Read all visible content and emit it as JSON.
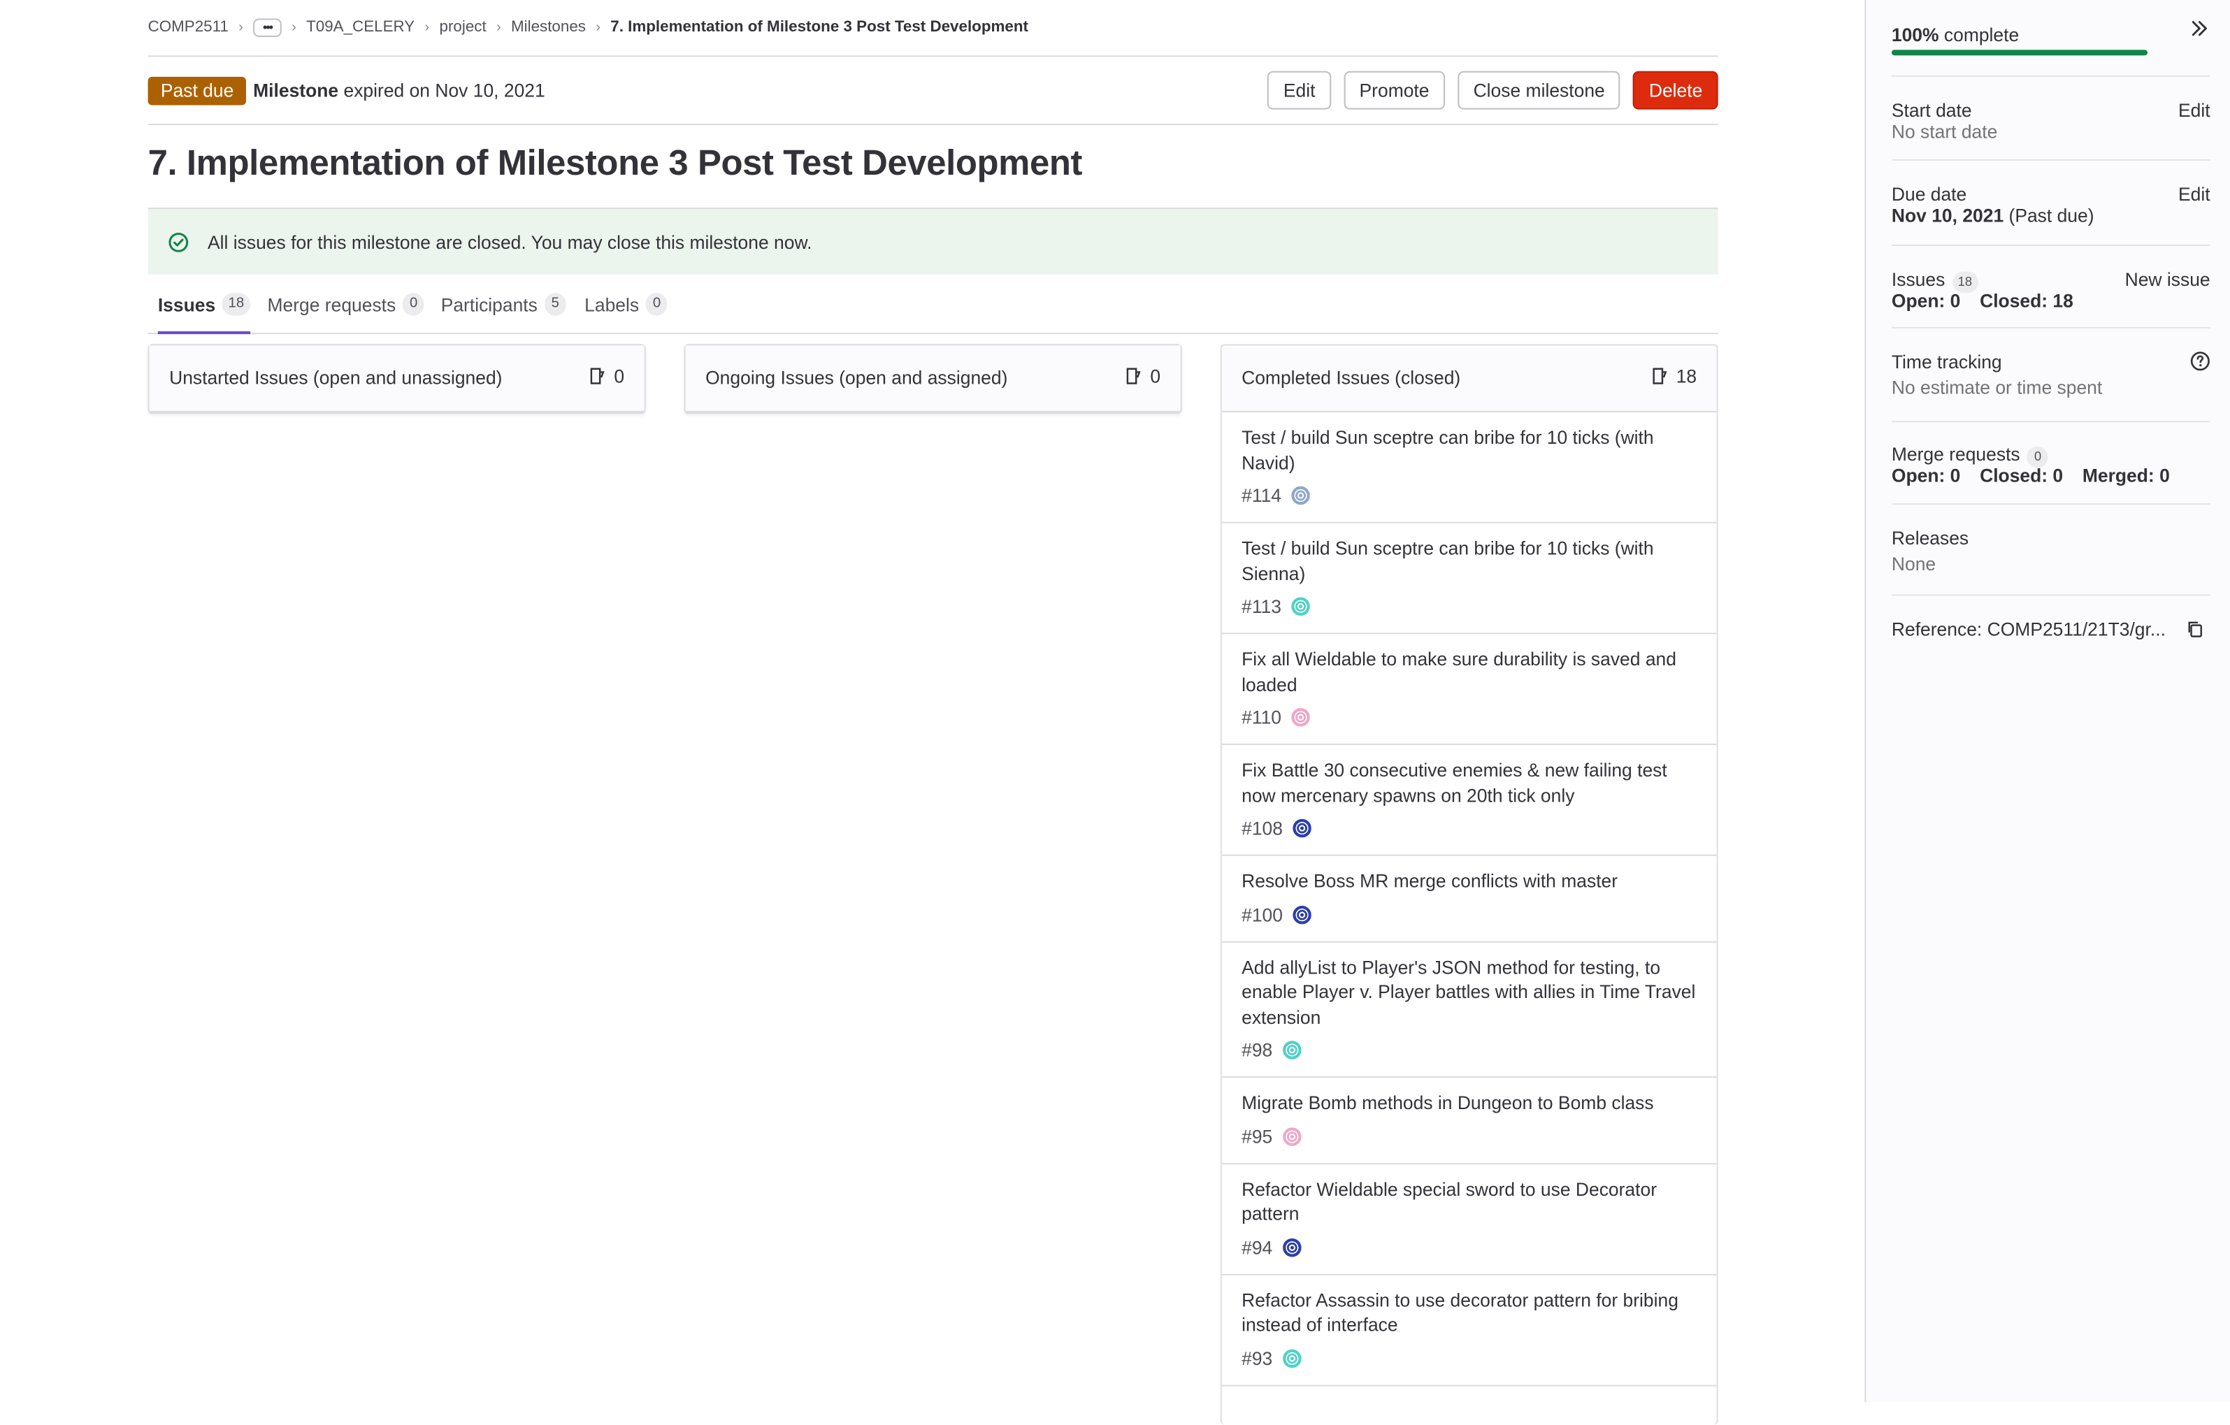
{
  "breadcrumb": {
    "items": [
      "COMP2511",
      "T09A_CELERY",
      "project",
      "Milestones"
    ],
    "current": "7. Implementation of Milestone 3 Post Test Development"
  },
  "header": {
    "status_badge": "Past due",
    "milestone_word": "Milestone",
    "expired_text": " expired on Nov 10, 2021",
    "buttons": {
      "edit": "Edit",
      "promote": "Promote",
      "close": "Close milestone",
      "delete": "Delete"
    }
  },
  "title": "7. Implementation of Milestone 3 Post Test Development",
  "alert": {
    "message": "All issues for this milestone are closed. You may close this milestone now."
  },
  "tabs": [
    {
      "label": "Issues",
      "count": "18"
    },
    {
      "label": "Merge requests",
      "count": "0"
    },
    {
      "label": "Participants",
      "count": "5"
    },
    {
      "label": "Labels",
      "count": "0"
    }
  ],
  "columns": {
    "unstarted": {
      "title": "Unstarted Issues (open and unassigned)",
      "count": "0"
    },
    "ongoing": {
      "title": "Ongoing Issues (open and assigned)",
      "count": "0"
    },
    "completed": {
      "title": "Completed Issues (closed)",
      "count": "18",
      "issues": [
        {
          "title": "Test / build Sun sceptre can bribe for 10 ticks (with Navid)",
          "ref": "#114",
          "avatar_color": "#8fa6c9"
        },
        {
          "title": "Test / build Sun sceptre can bribe for 10 ticks (with Sienna)",
          "ref": "#113",
          "avatar_color": "#4fd1c5"
        },
        {
          "title": "Fix all Wieldable to make sure durability is saved and loaded",
          "ref": "#110",
          "avatar_color": "#f0a6c8"
        },
        {
          "title": "Fix Battle 30 consecutive enemies & new failing test now mercenary spawns on 20th tick only",
          "ref": "#108",
          "avatar_color": "#2b3fa8"
        },
        {
          "title": "Resolve Boss MR merge conflicts with master",
          "ref": "#100",
          "avatar_color": "#2b3fa8"
        },
        {
          "title": "Add allyList to Player's JSON method for testing, to enable Player v. Player battles with allies in Time Travel extension",
          "ref": "#98",
          "avatar_color": "#4fd1c5"
        },
        {
          "title": "Migrate Bomb methods in Dungeon to Bomb class",
          "ref": "#95",
          "avatar_color": "#f0a6c8"
        },
        {
          "title": "Refactor Wieldable special sword to use Decorator pattern",
          "ref": "#94",
          "avatar_color": "#2b3fa8"
        },
        {
          "title": "Refactor Assassin to use decorator pattern for bribing instead of interface",
          "ref": "#93",
          "avatar_color": "#4fd1c5"
        }
      ]
    }
  },
  "sidebar": {
    "progress": {
      "percent": "100%",
      "suffix": " complete",
      "value": 100
    },
    "start_date": {
      "label": "Start date",
      "value": "No start date",
      "edit": "Edit"
    },
    "due_date": {
      "label": "Due date",
      "value": "Nov 10, 2021",
      "note": " (Past due)",
      "edit": "Edit"
    },
    "issues": {
      "label": "Issues",
      "count": "18",
      "new_issue": "New issue",
      "open": "Open: 0",
      "closed": "Closed: 18"
    },
    "time_tracking": {
      "label": "Time tracking",
      "value": "No estimate or time spent"
    },
    "merge_requests": {
      "label": "Merge requests",
      "count": "0",
      "open": "Open: 0",
      "closed": "Closed: 0",
      "merged": "Merged: 0"
    },
    "releases": {
      "label": "Releases",
      "value": "None"
    },
    "reference": {
      "label": "Reference: COMP2511/21T3/gr..."
    }
  },
  "colors": {
    "past_due": "#ab6100",
    "danger": "#dd2b0e",
    "success": "#108548",
    "tab_active": "#6e49cb"
  }
}
